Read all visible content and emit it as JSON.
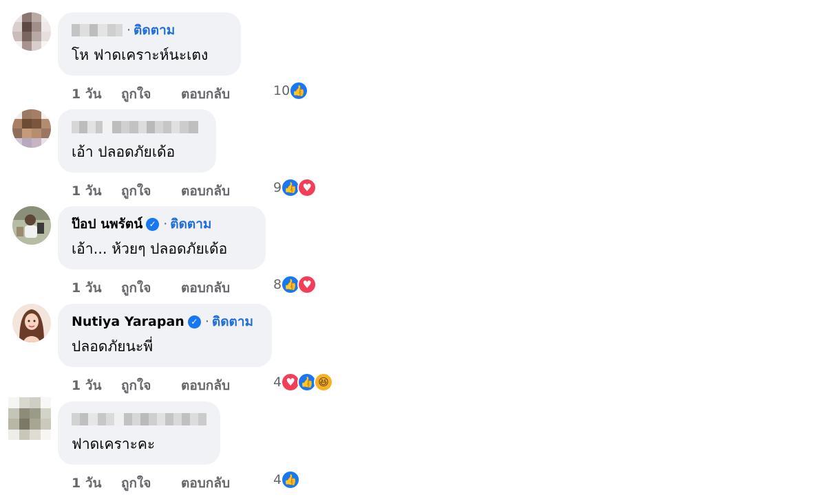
{
  "colors": {
    "link": "#216fdb",
    "meta": "#65676b",
    "bubble": "#f0f2f5",
    "like": "#1877f2",
    "love": "#f33e58",
    "haha": "#f7b125"
  },
  "comments": [
    {
      "author": "",
      "author_blurred": true,
      "follow": "ติดตาม",
      "text": "โห ฟาดเคราะห์นะเตง",
      "time": "1 วัน",
      "like": "ถูกใจ",
      "reply": "ตอบกลับ",
      "reaction_count": "10",
      "reactions": [
        "like-icon"
      ]
    },
    {
      "author": "",
      "author_blurred": true,
      "follow": "",
      "text": "เอ้า ปลอดภัยเด้อ",
      "time": "1 วัน",
      "like": "ถูกใจ",
      "reply": "ตอบกลับ",
      "reaction_count": "9",
      "reactions": [
        "like-icon",
        "love-icon"
      ]
    },
    {
      "author": "ป๊อป นพรัตน์",
      "author_blurred": false,
      "verified": true,
      "follow": "ติดตาม",
      "text": "เอ้า... ห้วยๆ ปลอดภัยเด้อ",
      "time": "1 วัน",
      "like": "ถูกใจ",
      "reply": "ตอบกลับ",
      "reaction_count": "8",
      "reactions": [
        "like-icon",
        "love-icon"
      ]
    },
    {
      "author": "Nutiya Yarapan",
      "author_blurred": false,
      "verified": true,
      "follow": "ติดตาม",
      "text": "ปลอดภัยนะพี่",
      "time": "1 วัน",
      "like": "ถูกใจ",
      "reply": "ตอบกลับ",
      "reaction_count": "4",
      "reactions": [
        "love-icon",
        "like-icon",
        "haha-icon"
      ]
    },
    {
      "author": "",
      "author_blurred": true,
      "follow": "",
      "text": "ฟาดเคราะคะ",
      "time": "1 วัน",
      "like": "ถูกใจ",
      "reply": "ตอบกลับ",
      "reaction_count": "4",
      "reactions": [
        "like-icon"
      ]
    }
  ]
}
